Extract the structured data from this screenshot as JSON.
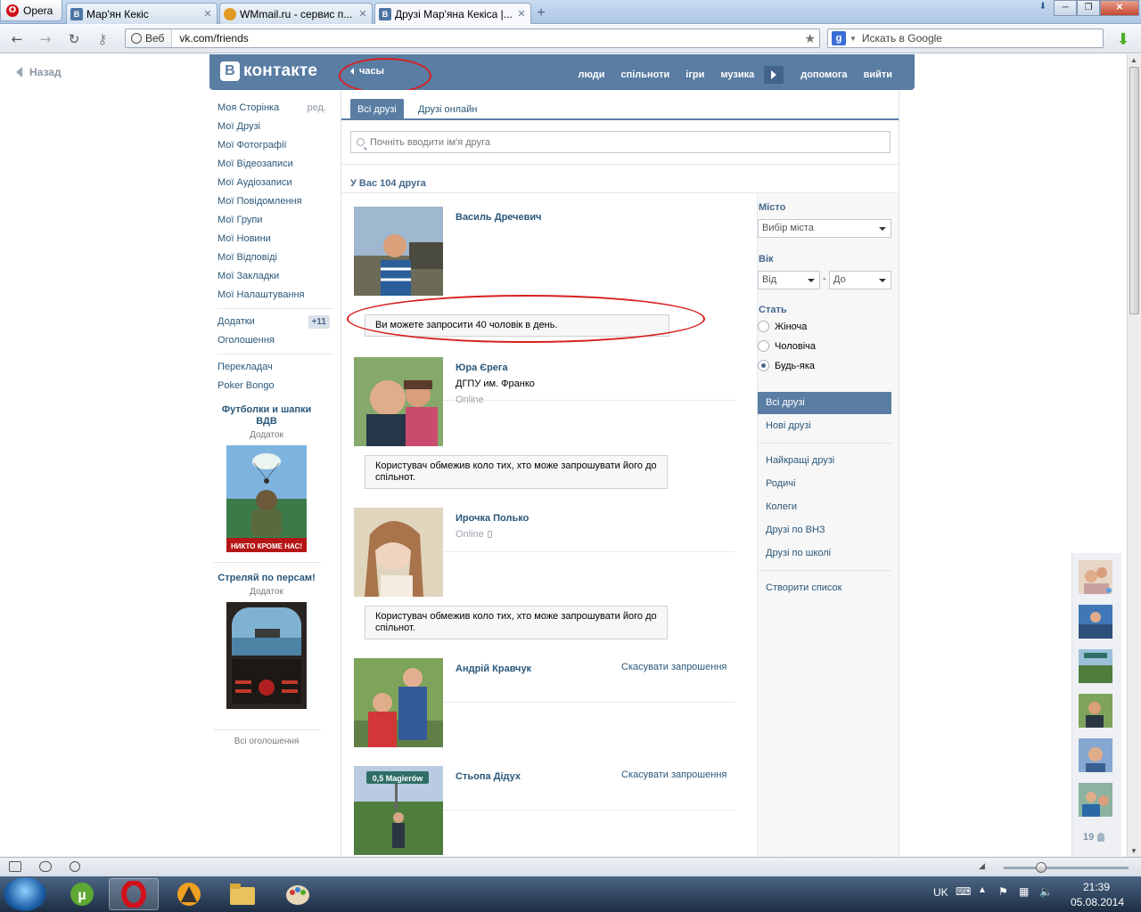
{
  "browser": {
    "menu_label": "Opera",
    "tabs": [
      {
        "title": "Мар'ян Кекіс"
      },
      {
        "title": "WMmail.ru - сервис п..."
      },
      {
        "title": "Друзі Мар'яна Кекіса |..."
      }
    ],
    "address_badge": "Веб",
    "url": "vk.com/friends",
    "search_placeholder": "Искать в Google"
  },
  "page": {
    "back_label": "Назад",
    "header": {
      "logo_text": "контакте",
      "logo_letter": "В",
      "status": "часы",
      "nav": [
        "люди",
        "спільноти",
        "ігри",
        "музика",
        "допомога",
        "вийти"
      ]
    },
    "left_menu": [
      {
        "label": "Моя Сторінка",
        "extra": "ред."
      },
      {
        "label": "Мої Друзі"
      },
      {
        "label": "Мої Фотографії"
      },
      {
        "label": "Мої Відеозаписи"
      },
      {
        "label": "Мої Аудіозаписи"
      },
      {
        "label": "Мої Повідомлення"
      },
      {
        "label": "Мої Групи"
      },
      {
        "label": "Мої Новини"
      },
      {
        "label": "Мої Відповіді"
      },
      {
        "label": "Мої Закладки"
      },
      {
        "label": "Мої Налаштування"
      }
    ],
    "left_menu2": [
      {
        "label": "Додатки",
        "badge": "+11"
      },
      {
        "label": "Оголошення"
      }
    ],
    "left_menu3": [
      {
        "label": "Перекладач"
      },
      {
        "label": "Poker Bongo"
      }
    ],
    "ads": [
      {
        "title": "Футболки и шапки ВДВ",
        "sub": "Додаток",
        "img_caption": "НИКТО КРОМЕ НАС!"
      },
      {
        "title": "Стреляй по персам!",
        "sub": "Додаток"
      }
    ],
    "all_ads": "Всі оголошення",
    "tabs": [
      "Всі друзі",
      "Друзі онлайн"
    ],
    "search_placeholder": "Почніть вводити ім'я друга",
    "count_text": "У Вас 104 друга",
    "friends": [
      {
        "name": "Василь Дречевич",
        "notice": "Ви можете запросити 40 чоловік в день."
      },
      {
        "name": "Юра Єрега",
        "info": "ДГПУ им. Франко",
        "online": "Online",
        "notice": "Користувач обмежив коло тих, хто може запрошувати його до спільнот."
      },
      {
        "name": "Ирочка Полько",
        "online": "Online",
        "notice": "Користувач обмежив коло тих, хто може запрошувати його до спільнот."
      },
      {
        "name": "Андрій Кравчук",
        "action": "Скасувати запрошення"
      },
      {
        "name": "Стьопа Дідух",
        "action": "Скасувати запрошення",
        "sign_text": "0,5 Magierów"
      }
    ],
    "filter": {
      "city_label": "Місто",
      "city_value": "Вибір міста",
      "age_label": "Вік",
      "age_from": "Від",
      "age_dash": "-",
      "age_to": "До",
      "gender_label": "Стать",
      "genders": [
        "Жіноча",
        "Чоловіча",
        "Будь-яка"
      ],
      "selected_gender": "Будь-яка",
      "lists": [
        "Всі друзі",
        "Нові друзі",
        "Найкращі друзі",
        "Родичі",
        "Колеги",
        "Друзі по ВНЗ",
        "Друзі по школі",
        "Створити список"
      ]
    },
    "minibar_count": "19"
  },
  "taskbar": {
    "lang": "UK",
    "time": "21:39",
    "date": "05.08.2014"
  },
  "colors": {
    "vk_blue": "#597da3",
    "link": "#2b587a",
    "annotation_red": "#d82020"
  }
}
